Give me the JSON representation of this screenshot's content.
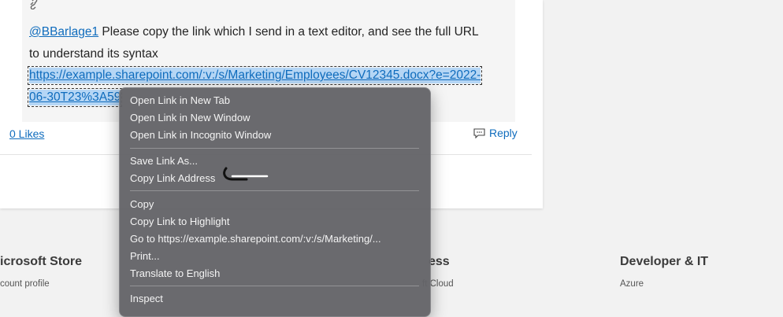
{
  "post": {
    "mention": "@BBarlage1",
    "body_line1": " Please copy the link which I send in a text editor, and see the full URL",
    "body_line2": "to understand its syntax",
    "url_line1": "https://example.sharepoint.com/:v:/s/Marketing/Employees/CV12345.docx?e=2022-",
    "url_line2": "06-30T23%3A59"
  },
  "actions": {
    "likes": "0 Likes",
    "reply": "Reply"
  },
  "footer": {
    "col1_heading": "icrosoft Store",
    "col1_link": "count profile",
    "col2_heading": "ess",
    "col2_link": "ft Cloud",
    "col3_heading": "Developer & IT",
    "col3_link": "Azure"
  },
  "context_menu": {
    "open_new_tab": "Open Link in New Tab",
    "open_new_window": "Open Link in New Window",
    "open_incognito": "Open Link in Incognito Window",
    "save_link_as": "Save Link As...",
    "copy_link_address": "Copy Link Address",
    "copy": "Copy",
    "copy_link_to_highlight": "Copy Link to Highlight",
    "go_to": "Go to https://example.sharepoint.com/:v:/s/Marketing/...",
    "print": "Print...",
    "translate": "Translate to English",
    "inspect": "Inspect"
  },
  "colors": {
    "link": "#0f6cbd",
    "menu_bg": "#646468",
    "selection": "#b5d6f5"
  }
}
